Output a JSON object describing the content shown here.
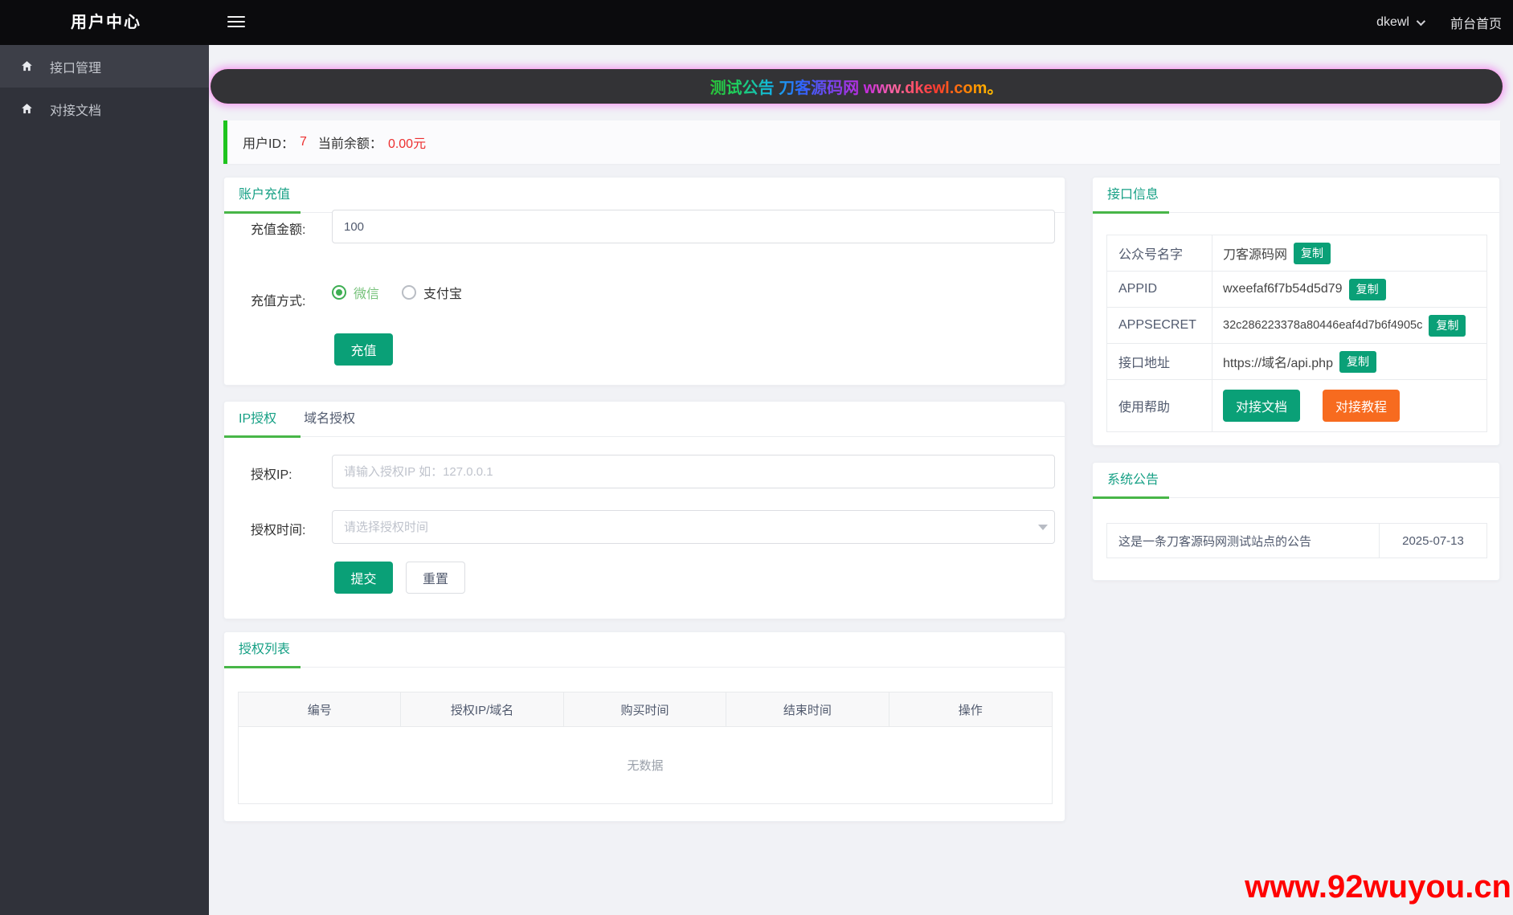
{
  "header": {
    "app_title": "用户中心",
    "user_menu": "dkewl",
    "frontend_link": "前台首页"
  },
  "sidebar": {
    "items": [
      {
        "label": "接口管理"
      },
      {
        "label": "对接文档"
      }
    ]
  },
  "banner": {
    "text": "测试公告 刀客源码网 www.dkewl.com。"
  },
  "user_info": {
    "id_label": "用户ID：",
    "id_value": "7",
    "balance_label": "当前余额：",
    "balance_value": "0.00元"
  },
  "recharge": {
    "title": "账户充值",
    "amount_label": "充值金额:",
    "amount_value": "100",
    "method_label": "充值方式:",
    "methods": [
      {
        "label": "微信",
        "selected": true
      },
      {
        "label": "支付宝",
        "selected": false
      }
    ],
    "submit_label": "充值"
  },
  "authorize": {
    "tabs": [
      "IP授权",
      "域名授权"
    ],
    "active_tab": "IP授权",
    "ip_label": "授权IP:",
    "ip_placeholder": "请输入授权IP 如：127.0.0.1",
    "time_label": "授权时间:",
    "time_placeholder": "请选择授权时间",
    "submit_label": "提交",
    "reset_label": "重置"
  },
  "auth_list": {
    "title": "授权列表",
    "headers": [
      "编号",
      "授权IP/域名",
      "购买时间",
      "结束时间",
      "操作"
    ],
    "empty_text": "无数据"
  },
  "api_info": {
    "title": "接口信息",
    "copy_label": "复制",
    "rows": [
      {
        "label": "公众号名字",
        "value": "刀客源码网"
      },
      {
        "label": "APPID",
        "value": "wxeefaf6f7b54d5d79"
      },
      {
        "label": "APPSECRET",
        "value": "32c286223378a80446eaf4d7b6f4905c"
      },
      {
        "label": "接口地址",
        "value": "https://域名/api.php"
      }
    ],
    "help_label": "使用帮助",
    "doc_button": "对接文档",
    "tutorial_button": "对接教程"
  },
  "announcement": {
    "title": "系统公告",
    "content": "这是一条刀客源码网测试站点的公告",
    "date": "2025-07-13"
  },
  "watermark": "www.92wuyou.cn",
  "colors": {
    "accent_teal": "#0aa077",
    "title_teal": "#16a085",
    "underline_green": "#48b648",
    "info_bar_green": "#1ec41e",
    "orange": "#f76b1f",
    "red": "#ed2f2f",
    "watermark_red": "#ff0000",
    "header_bg": "#0b0b0d",
    "sidebar_bg": "#30323a",
    "page_bg": "#f1f2f6"
  }
}
